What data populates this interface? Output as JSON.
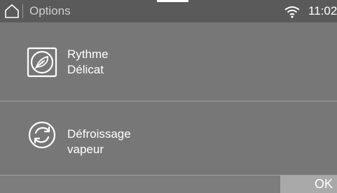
{
  "header": {
    "title": "Options",
    "time": "11:02"
  },
  "options": [
    {
      "line1": "Rythme",
      "line2": "Délicat",
      "icon": "feather-icon"
    },
    {
      "line1": "Défroissage",
      "line2": "vapeur",
      "icon": "circular-arrows-icon"
    }
  ],
  "footer": {
    "ok_label": "OK"
  },
  "colors": {
    "background": "#777777",
    "statusbar": "#5a5a5a",
    "ok_button": "#a9a9a9",
    "text": "#ffffff"
  }
}
